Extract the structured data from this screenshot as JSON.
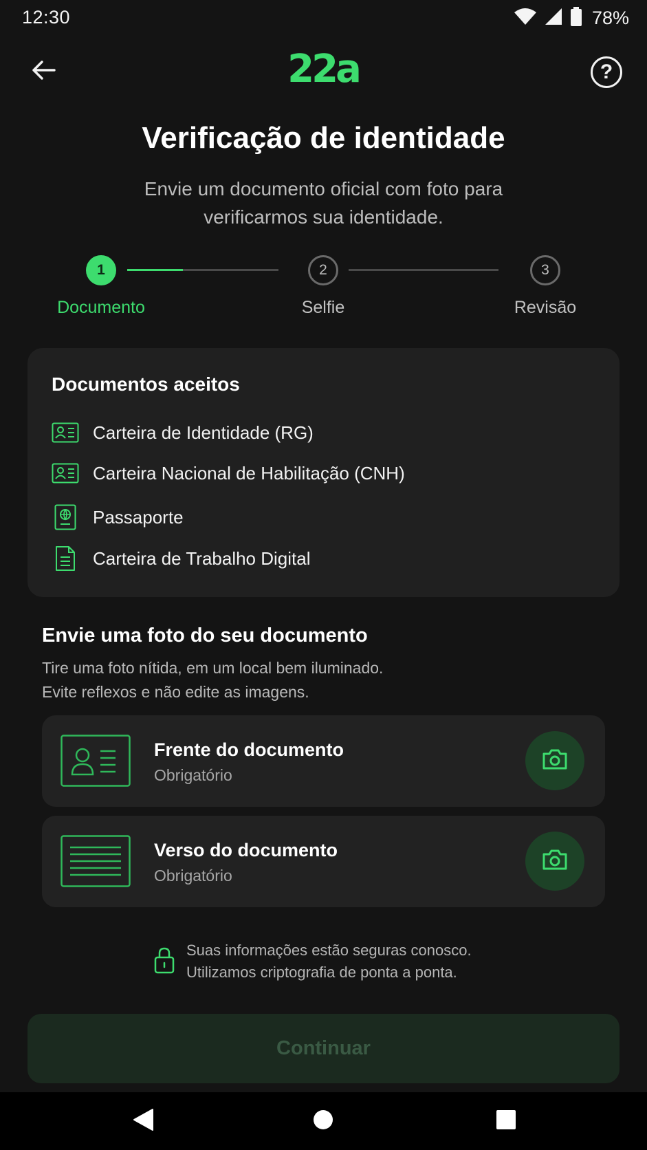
{
  "status_bar": {
    "time": "12:30",
    "battery": "78%"
  },
  "header": {
    "logo": "22a",
    "help_symbol": "?"
  },
  "page": {
    "title": "Verificação de identidade",
    "subtitle": "Envie um documento oficial com foto para verificarmos sua identidade."
  },
  "stepper": {
    "steps": [
      {
        "number": "1",
        "label": "Documento",
        "state": "active"
      },
      {
        "number": "2",
        "label": "Selfie",
        "state": "inactive"
      },
      {
        "number": "3",
        "label": "Revisão",
        "state": "inactive"
      }
    ],
    "progress_first_segment": 0.37
  },
  "accepted_docs": {
    "title": "Documentos aceitos",
    "items": [
      {
        "label": "Carteira de Identidade (RG)",
        "icon": "id-card-icon"
      },
      {
        "label": "Carteira Nacional de Habilitação (CNH)",
        "icon": "id-card-icon"
      },
      {
        "label": "Passaporte",
        "icon": "passport-icon"
      },
      {
        "label": "Carteira de Trabalho Digital",
        "icon": "document-icon"
      }
    ]
  },
  "upload": {
    "title": "Envie uma foto do seu documento",
    "desc_line1": "Tire uma foto nítida, em um local bem iluminado.",
    "desc_line2": "Evite reflexos e não edite as imagens.",
    "cards": [
      {
        "title": "Frente do documento",
        "subtitle": "Obrigatório",
        "icon": "camera-icon"
      },
      {
        "title": "Verso do documento",
        "subtitle": "Obrigatório",
        "icon": "camera-icon"
      }
    ]
  },
  "security": {
    "line1": "Suas informações estão seguras conosco.",
    "line2": "Utilizamos criptografia de ponta a ponta."
  },
  "continue_label": "Continuar",
  "colors": {
    "accent": "#3ddc6e",
    "background": "#141414",
    "card": "#202020"
  }
}
